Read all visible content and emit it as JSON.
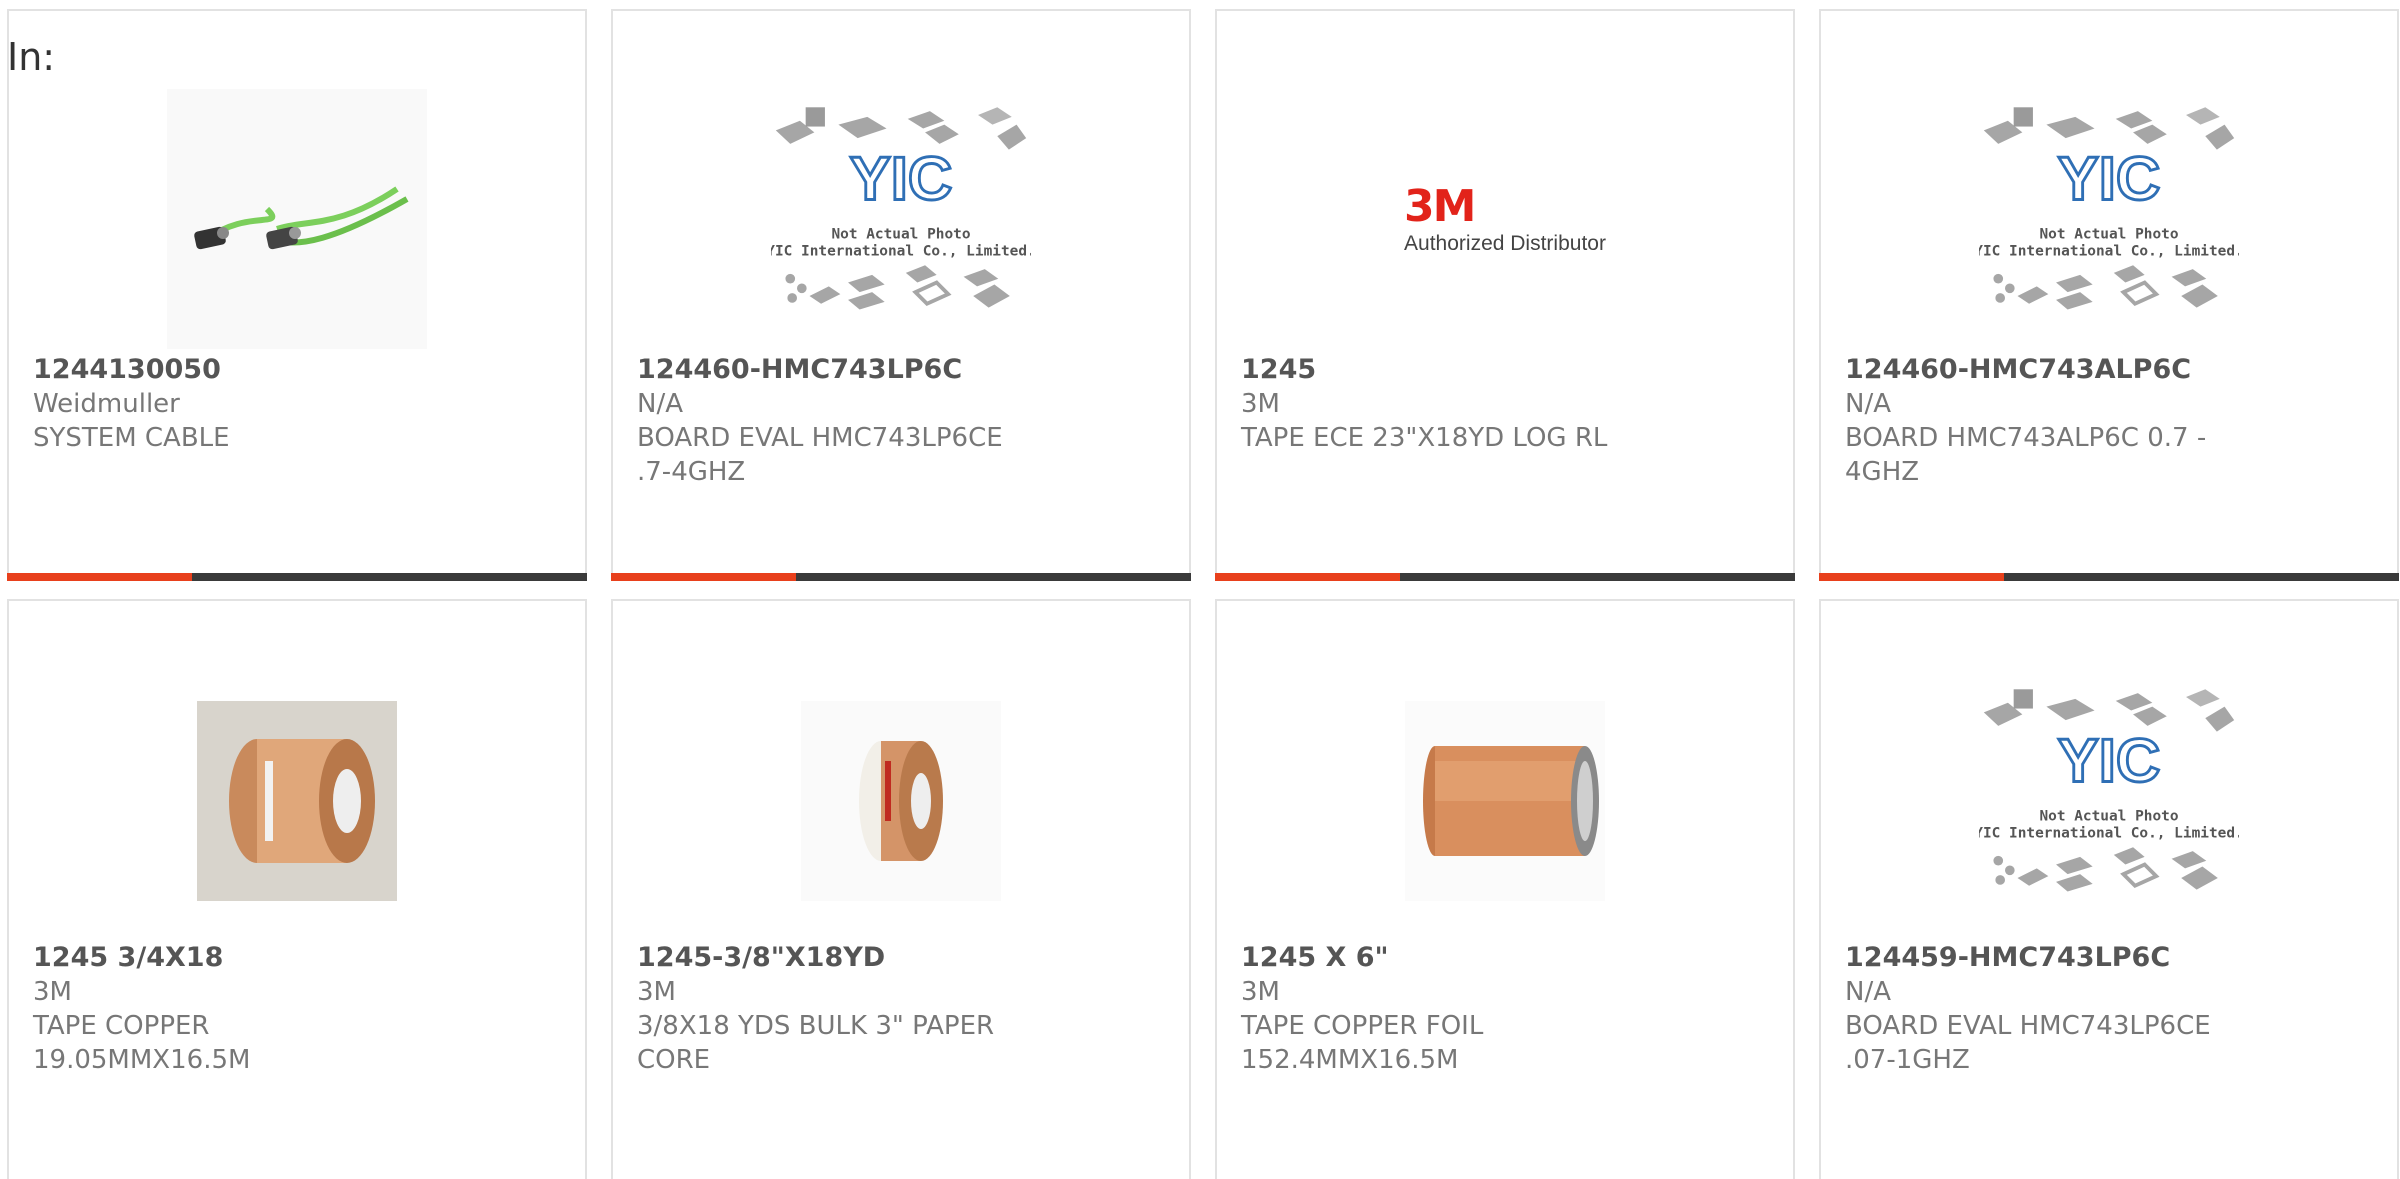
{
  "header": {
    "in_label": "In:"
  },
  "colors": {
    "accent": "#e8401c",
    "bar": "#3a3a3a",
    "part_text": "#555555",
    "meta_text": "#777777"
  },
  "yic_placeholder": {
    "logo_text": "YIC",
    "caption_line1": "Not Actual Photo",
    "caption_line2": "YIC International Co., Limited."
  },
  "authorized_badge": {
    "brand": "3M",
    "text": "Authorized Distributor"
  },
  "products": [
    {
      "part": "1244130050",
      "manufacturer": "Weidmuller",
      "description": "SYSTEM CABLE",
      "image": "ethernet-cable-icon"
    },
    {
      "part": "124460-HMC743LP6C",
      "manufacturer": "N/A",
      "description": "BOARD EVAL HMC743LP6CE .7-4GHZ",
      "image": "yic-placeholder-icon"
    },
    {
      "part": "1245",
      "manufacturer": "3M",
      "description": "TAPE ECE 23\"X18YD LOG RL",
      "image": "3m-authorized-logo"
    },
    {
      "part": "124460-HMC743ALP6C",
      "manufacturer": "N/A",
      "description": "BOARD HMC743ALP6C 0.7 - 4GHZ",
      "image": "yic-placeholder-icon"
    },
    {
      "part": "1245 3/4X18",
      "manufacturer": "3M",
      "description": "TAPE COPPER 19.05MMX16.5M",
      "image": "copper-tape-roll-icon"
    },
    {
      "part": "1245-3/8\"X18YD",
      "manufacturer": "3M",
      "description": "3/8X18 YDS BULK 3\" PAPER CORE",
      "image": "copper-tape-narrow-icon"
    },
    {
      "part": "1245 X 6\"",
      "manufacturer": "3M",
      "description": "TAPE COPPER FOIL 152.4MMX16.5M",
      "image": "copper-foil-roll-icon"
    },
    {
      "part": "124459-HMC743LP6C",
      "manufacturer": "N/A",
      "description": "BOARD EVAL HMC743LP6CE .07-1GHZ",
      "image": "yic-placeholder-icon"
    }
  ]
}
